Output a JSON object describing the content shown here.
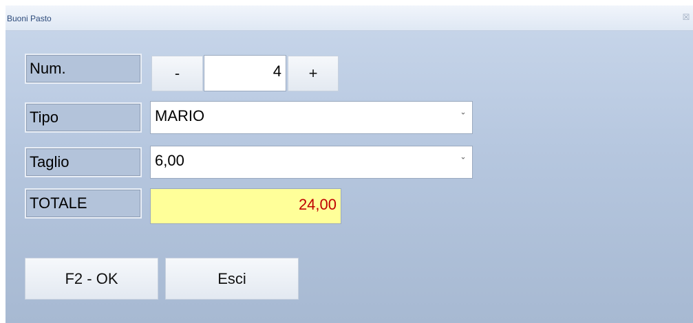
{
  "window": {
    "title": "Buoni Pasto",
    "close_glyph": "☒"
  },
  "form": {
    "num": {
      "label": "Num.",
      "minus_label": "-",
      "value": "4",
      "plus_label": "+"
    },
    "tipo": {
      "label": "Tipo",
      "selected": "MARIO"
    },
    "taglio": {
      "label": "Taglio",
      "selected": "6,00"
    },
    "totale": {
      "label": "TOTALE",
      "value": "24,00"
    }
  },
  "actions": {
    "ok_label": "F2 - OK",
    "exit_label": "Esci"
  },
  "colors": {
    "total_bg": "#ffff99",
    "total_text": "#c00000"
  },
  "icons": {
    "close": "close-icon",
    "dropdown": "chevron-down-icon"
  }
}
